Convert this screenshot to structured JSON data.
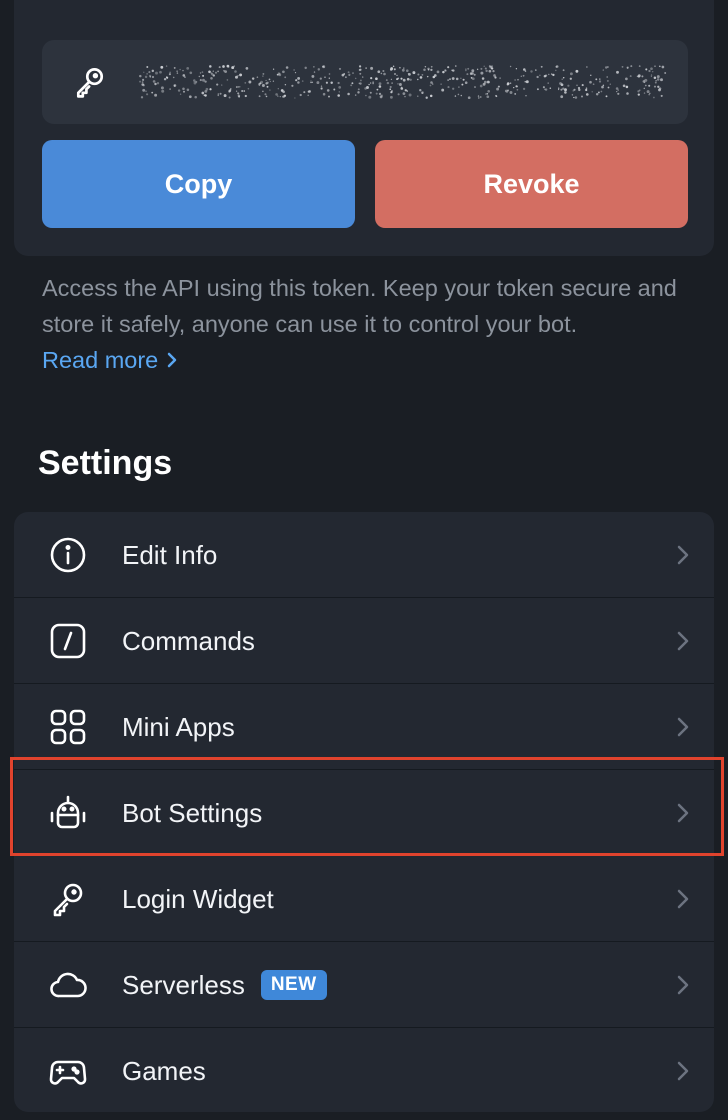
{
  "token_panel": {
    "token_masked": "••••••••••••••••••••••••••••••••",
    "copy_label": "Copy",
    "revoke_label": "Revoke"
  },
  "description": {
    "text": "Access the API using this token. Keep your token secure and store it safely, anyone can use it to control your bot.",
    "read_more": "Read more"
  },
  "settings": {
    "title": "Settings",
    "items": [
      {
        "label": "Edit Info",
        "icon": "info-icon"
      },
      {
        "label": "Commands",
        "icon": "slash-command-icon"
      },
      {
        "label": "Mini Apps",
        "icon": "grid-apps-icon"
      },
      {
        "label": "Bot Settings",
        "icon": "robot-icon",
        "highlighted": true
      },
      {
        "label": "Login Widget",
        "icon": "key-icon"
      },
      {
        "label": "Serverless",
        "icon": "cloud-icon",
        "badge": "NEW"
      },
      {
        "label": "Games",
        "icon": "gamepad-icon"
      }
    ]
  },
  "colors": {
    "background": "#1a1e24",
    "card": "#232831",
    "copy_button": "#4a8ad8",
    "revoke_button": "#d36e62",
    "link": "#5aa7f2",
    "badge": "#3f88d9",
    "highlight_outline": "#e0432d"
  }
}
